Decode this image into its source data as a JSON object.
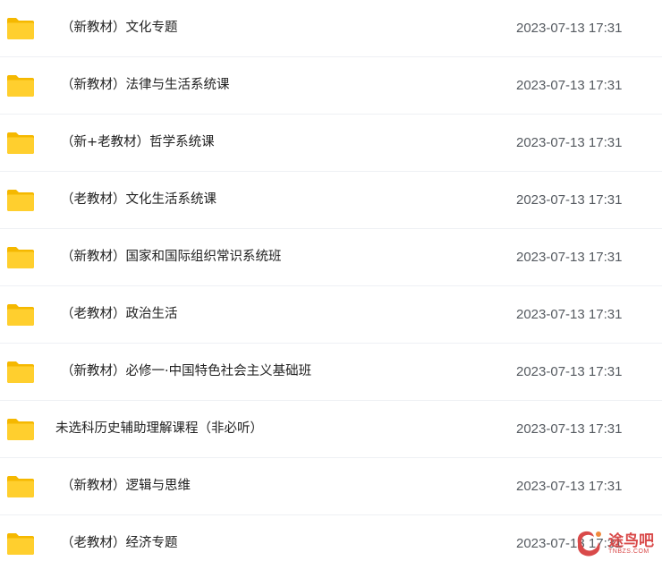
{
  "colors": {
    "folder_back": "#F5B800",
    "folder_front": "#FFCF2E",
    "row_divider": "#EEF0F4",
    "watermark": "#D94A4A"
  },
  "files": [
    {
      "name": "（新教材）文化专题",
      "date": "2023-07-13 17:31",
      "icon": "folder-icon"
    },
    {
      "name": "（新教材）法律与生活系统课",
      "date": "2023-07-13 17:31",
      "icon": "folder-icon"
    },
    {
      "name": "（新+老教材）哲学系统课",
      "date": "2023-07-13 17:31",
      "icon": "folder-icon"
    },
    {
      "name": "（老教材）文化生活系统课",
      "date": "2023-07-13 17:31",
      "icon": "folder-icon"
    },
    {
      "name": "（新教材）国家和国际组织常识系统班",
      "date": "2023-07-13 17:31",
      "icon": "folder-icon"
    },
    {
      "name": "（老教材）政治生活",
      "date": "2023-07-13 17:31",
      "icon": "folder-icon"
    },
    {
      "name": "（新教材）必修一·中国特色社会主义基础班",
      "date": "2023-07-13 17:31",
      "icon": "folder-icon"
    },
    {
      "name": "未选科历史辅助理解课程（非必听）",
      "date": "2023-07-13 17:31",
      "icon": "folder-icon"
    },
    {
      "name": "（新教材）逻辑与思维",
      "date": "2023-07-13 17:31",
      "icon": "folder-icon"
    },
    {
      "name": "（老教材）经济专题",
      "date": "2023-07-13 17:31",
      "icon": "folder-icon"
    }
  ],
  "watermark": {
    "title": "途鸟吧",
    "subtitle": "TNBZS.COM",
    "icon": "tunba-logo-icon"
  }
}
